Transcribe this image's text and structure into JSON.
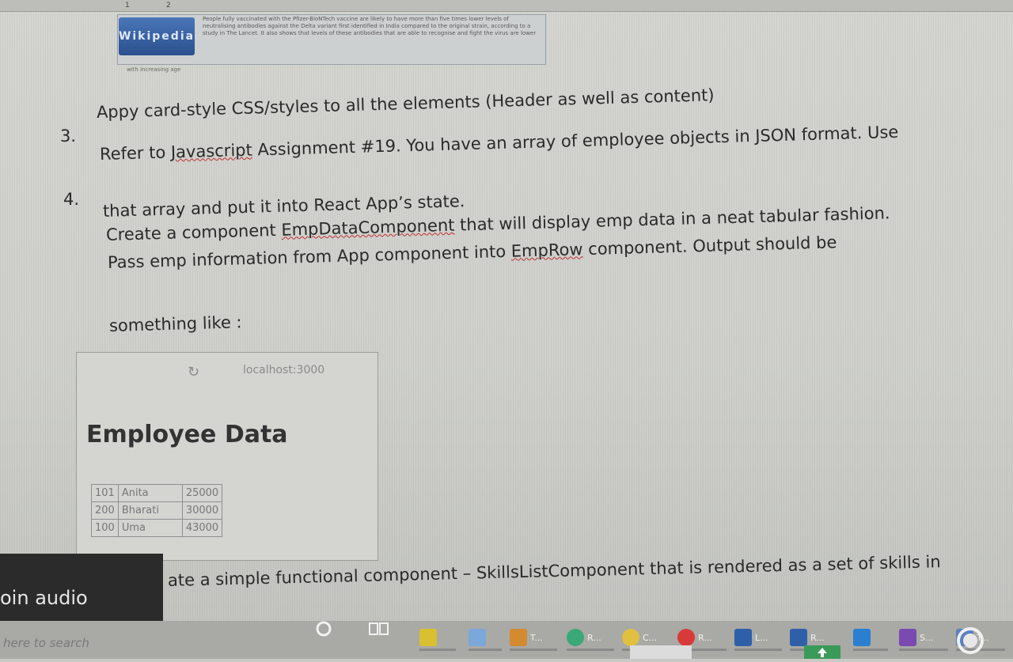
{
  "ruler": {
    "marks": [
      "1",
      "2"
    ]
  },
  "header_excerpt": {
    "logo_text": "Wikipedia",
    "paragraph": "People fully vaccinated with the Pfizer-BioNTech vaccine are likely to have more than five times lower levels of neutralising antibodies against the Delta variant first identified in India compared to the original strain, according to a study in The Lancet. It also shows that levels of these antibodies that are able to recognise and fight the virus are lower",
    "age_note": "with increasing age"
  },
  "list_item_3": {
    "number": "3.",
    "text": "Appy card-style CSS/styles to all the elements (Header as well as content)"
  },
  "list_item_4": {
    "number": "4.",
    "line1_pre": "Refer to ",
    "line1_link": "Javascript",
    "line1_post": " Assignment #19. You have an array of employee objects in JSON format. Use",
    "line2": "that array and put it into React App’s state.",
    "line3_pre": "Create a component ",
    "line3_comp": "EmpDataComponent",
    "line3_post": " that will display emp data in a neat tabular fashion.",
    "line4_pre": "Pass emp information from App component into ",
    "line4_comp": "EmpRow",
    "line4_post": " component. Output should be",
    "line5": "something like :"
  },
  "example_screenshot": {
    "refresh_symbol": "↻",
    "url": "localhost:3000",
    "title": "Employee Data",
    "rows": [
      {
        "id": "101",
        "name": "Anita",
        "salary": "25000"
      },
      {
        "id": "200",
        "name": "Bharati",
        "salary": "30000"
      },
      {
        "id": "100",
        "name": "Uma",
        "salary": "43000"
      }
    ]
  },
  "next_item": {
    "text": "ate a simple functional component – SkillsListComponent that is rendered as a set of skills in"
  },
  "join_audio": {
    "label": "oin audio"
  },
  "taskbar": {
    "search_placeholder": "here to search",
    "apps": [
      "T...",
      "R...",
      "C...",
      "R...",
      "L...",
      "R...",
      "S...",
      "T..."
    ]
  }
}
